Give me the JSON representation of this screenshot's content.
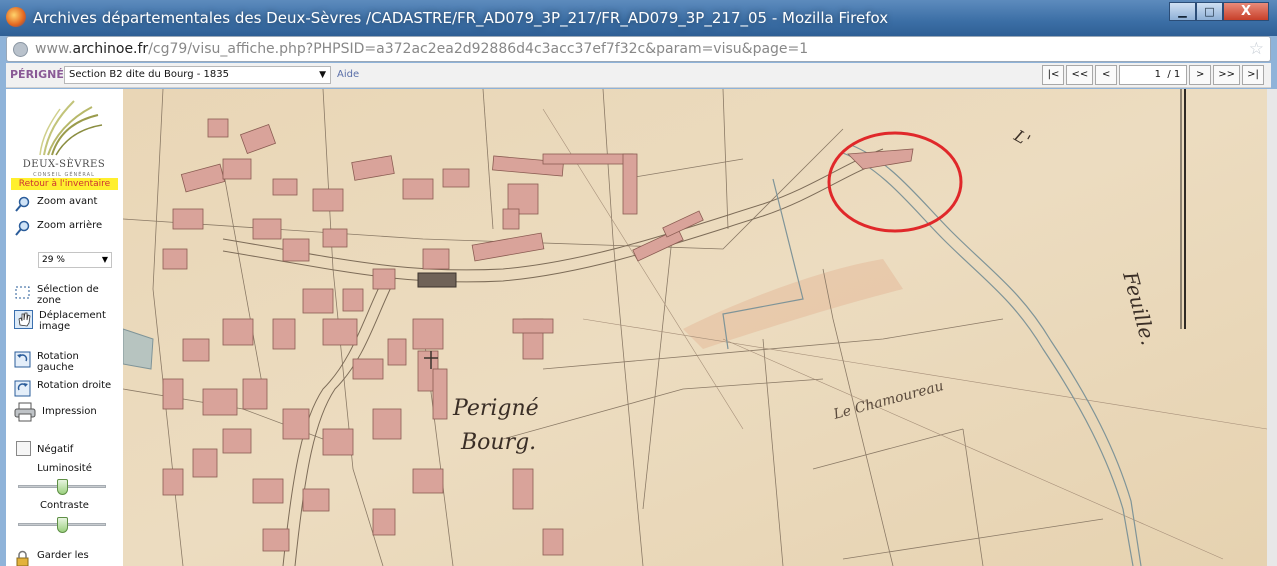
{
  "window": {
    "title": "Archives départementales des Deux-Sèvres /CADASTRE/FR_AD079_3P_217/FR_AD079_3P_217_05 - Mozilla Firefox",
    "minimize": "▁",
    "maximize": "□",
    "close": "X"
  },
  "address": {
    "prefix": "www.",
    "domain": "archinoe.fr",
    "path": "/cg79/visu_affiche.php?PHPSID=a372ac2ea2d92886d4c3acc37ef7f32c&param=visu&page=1"
  },
  "toolbar": {
    "site_name": "PÉRIGNÉ",
    "section_selected": "Section B2 dite du Bourg - 1835",
    "help": "Aide",
    "pager": {
      "first": "|<",
      "prev_many": "<<",
      "prev": "<",
      "page": "1",
      "total": "/ 1",
      "next": ">",
      "next_many": ">>",
      "last": ">|"
    }
  },
  "sidebar": {
    "logo_text": "DEUX-SÈVRES",
    "logo_sub": "CONSEIL GÉNÉRAL",
    "back": "Retour à l'inventaire",
    "zoom_in": "Zoom avant",
    "zoom_out": "Zoom arrière",
    "zoom_level": "29 %",
    "select_zone": "Sélection de zone",
    "move_image": "Déplacement image",
    "rotate_left": "Rotation gauche",
    "rotate_right": "Rotation droite",
    "print": "Impression",
    "negative": "Négatif",
    "brightness": "Luminosité",
    "contrast": "Contraste",
    "keep": "Garder les"
  },
  "map": {
    "label_town_1": "Perigné",
    "label_town_2": "Bourg.",
    "label_place": "Le Chamoureau",
    "label_river": "Feuille.",
    "label_top": "L'",
    "annotation": "circled feature"
  },
  "colors": {
    "parchment": "#ebd8b8",
    "building": "#d9a39a",
    "ink": "#6b5a4a",
    "water": "#8fa3a8",
    "highlight_circle": "#e0282a"
  }
}
